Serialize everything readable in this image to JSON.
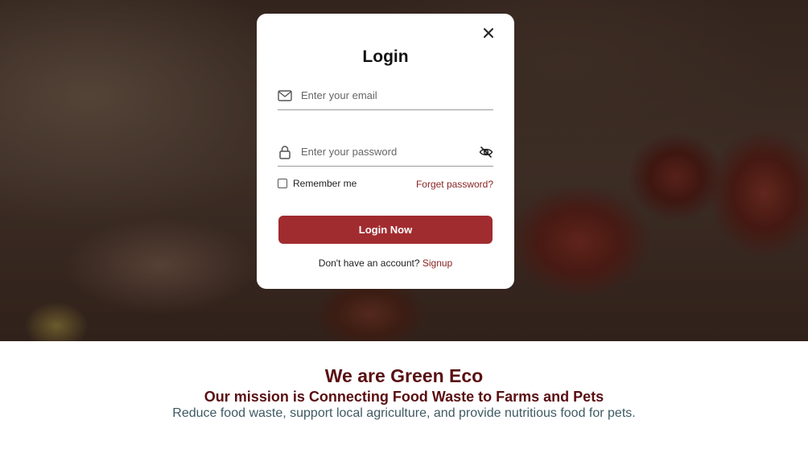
{
  "login": {
    "title": "Login",
    "email_placeholder": "Enter your email",
    "password_placeholder": "Enter your password",
    "remember_label": "Remember me",
    "forgot_label": "Forget password?",
    "submit_label": "Login Now",
    "signup_prompt": "Don't have an account?",
    "signup_label": "Signup"
  },
  "about": {
    "heading": "We are Green Eco",
    "mission": "Our mission is Connecting Food Waste to Farms and Pets",
    "description": "Reduce food waste, support local agriculture, and provide nutritious food for pets."
  },
  "icons": {
    "close": "close-icon",
    "email": "envelope-icon",
    "password": "lock-icon",
    "visibility": "eye-off-icon"
  },
  "colors": {
    "accent": "#a12c2f",
    "heading": "#5a0f12",
    "link": "#8b2323",
    "body_text": "#3e5a63"
  }
}
